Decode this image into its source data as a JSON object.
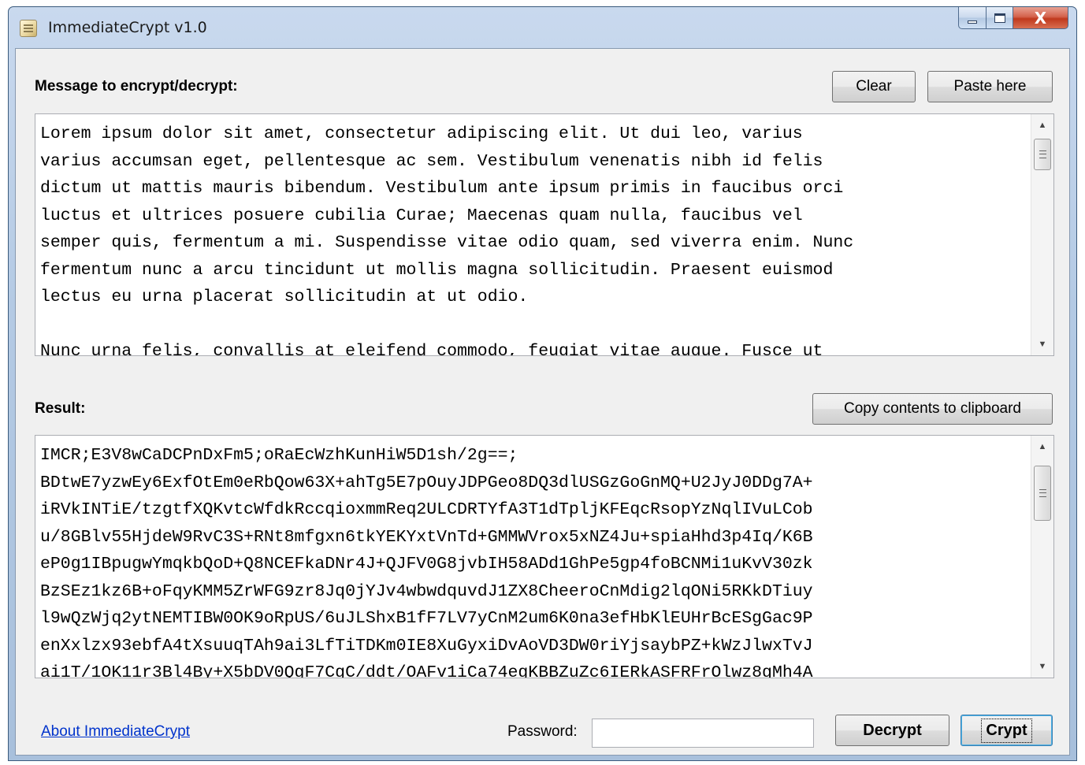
{
  "window": {
    "title": "ImmediateCrypt v1.0",
    "controls": {
      "minimize": "minimize",
      "maximize": "maximize",
      "close": "X"
    }
  },
  "message": {
    "label": "Message to encrypt/decrypt:",
    "clear_label": "Clear",
    "paste_label": "Paste here",
    "text": "Lorem ipsum dolor sit amet, consectetur adipiscing elit. Ut dui leo, varius\nvarius accumsan eget, pellentesque ac sem. Vestibulum venenatis nibh id felis\ndictum ut mattis mauris bibendum. Vestibulum ante ipsum primis in faucibus orci\nluctus et ultrices posuere cubilia Curae; Maecenas quam nulla, faucibus vel\nsemper quis, fermentum a mi. Suspendisse vitae odio quam, sed viverra enim. Nunc\nfermentum nunc a arcu tincidunt ut mollis magna sollicitudin. Praesent euismod\nlectus eu urna placerat sollicitudin at ut odio.\n\nNunc urna felis, convallis at eleifend commodo, feugiat vitae augue. Fusce ut"
  },
  "result": {
    "label": "Result:",
    "copy_label": "Copy contents to clipboard",
    "text": "IMCR;E3V8wCaDCPnDxFm5;oRaEcWzhKunHiW5D1sh/2g==;\nBDtwE7yzwEy6ExfOtEm0eRbQow63X+ahTg5E7pOuyJDPGeo8DQ3dlUSGzGoGnMQ+U2JyJ0DDg7A+\niRVkINTiE/tzgtfXQKvtcWfdkRccqioxmmReq2ULCDRTYfA3T1dTpljKFEqcRsopYzNqlIVuLCob\nu/8GBlv55HjdeW9RvC3S+RNt8mfgxn6tkYEKYxtVnTd+GMMWVrox5xNZ4Ju+spiaHhd3p4Iq/K6B\neP0g1IBpugwYmqkbQoD+Q8NCEFkaDNr4J+QJFV0G8jvbIH58ADd1GhPe5gp4foBCNMi1uKvV30zk\nBzSEz1kz6B+oFqyKMM5ZrWFG9zr8Jq0jYJv4wbwdquvdJ1ZX8CheeroCnMdig2lqONi5RKkDTiuy\nl9wQzWjq2ytNEMTIBW0OK9oRpUS/6uJLShxB1fF7LV7yCnM2um6K0na3efHbKlEUHrBcESgGac9P\nenXxlzx93ebfA4tXsuuqTAh9ai3LfTiTDKm0IE8XuGyxiDvAoVD3DW0riYjsaybPZ+kWzJlwxTvJ\nai1T/1OK11r3Bl4By+X5bDV0QgF7CgC/ddt/OAFv1iCa74egKBBZuZc6IERkASFRFrOlwz8gMh4A"
  },
  "footer": {
    "about_label": "About ImmediateCrypt",
    "password_label": "Password:",
    "password_value": "",
    "decrypt_label": "Decrypt",
    "crypt_label": "Crypt"
  }
}
